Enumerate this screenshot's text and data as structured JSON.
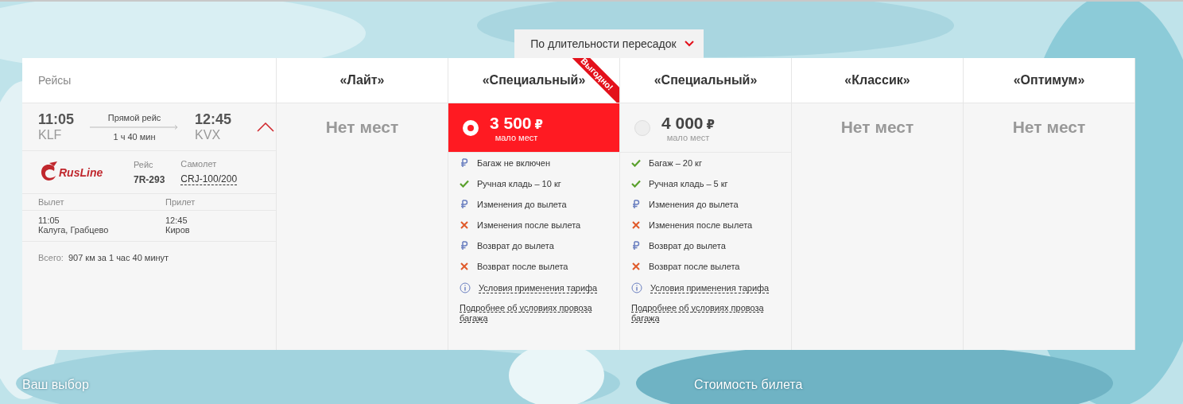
{
  "sort": {
    "label": "По длительности пересадок"
  },
  "flights_header": "Рейсы",
  "flight": {
    "departure_time": "11:05",
    "departure_code": "KLF",
    "type": "Прямой рейс",
    "duration": "1 ч 40 мин",
    "arrival_time": "12:45",
    "arrival_code": "KVX",
    "expanded": true,
    "airline": "RusLine",
    "flight_label": "Рейс",
    "flight_number": "7R-293",
    "aircraft_label": "Самолет",
    "aircraft": "CRJ-100/200",
    "departure_label": "Вылет",
    "arrival_label": "Прилет",
    "departure_time_detail": "11:05",
    "departure_city": "Калуга, Грабцево",
    "arrival_time_detail": "12:45",
    "arrival_city": "Киров",
    "total_label": "Всего:",
    "total": "907 км за 1 час 40 минут"
  },
  "tariffs": [
    {
      "name": "«Лайт»",
      "kind": "none",
      "status": "Нет мест"
    },
    {
      "name": "«Специальный»",
      "kind": "fare",
      "badge": "Выгодно!",
      "selected": true,
      "price": "3 500",
      "currency": "₽",
      "note": "мало мест",
      "features": [
        {
          "kind": "paid",
          "text": "Багаж не включен"
        },
        {
          "kind": "included",
          "text": "Ручная кладь – 10 кг"
        },
        {
          "kind": "paid",
          "text": "Изменения до вылета"
        },
        {
          "kind": "excluded",
          "text": "Изменения после вылета"
        },
        {
          "kind": "paid",
          "text": "Возврат до вылета"
        },
        {
          "kind": "excluded",
          "text": "Возврат после вылета"
        }
      ],
      "rules_link": "Условия применения тарифа",
      "baggage_link": "Подробнее об условиях провоза багажа"
    },
    {
      "name": "«Специальный»",
      "kind": "fare",
      "selected": false,
      "price": "4 000",
      "currency": "₽",
      "note": "мало мест",
      "features": [
        {
          "kind": "included",
          "text": "Багаж – 20 кг"
        },
        {
          "kind": "included",
          "text": "Ручная кладь – 5 кг"
        },
        {
          "kind": "paid",
          "text": "Изменения до вылета"
        },
        {
          "kind": "excluded",
          "text": "Изменения после вылета"
        },
        {
          "kind": "paid",
          "text": "Возврат до вылета"
        },
        {
          "kind": "excluded",
          "text": "Возврат после вылета"
        }
      ],
      "rules_link": "Условия применения тарифа",
      "baggage_link": "Подробнее об условиях провоза багажа"
    },
    {
      "name": "«Классик»",
      "kind": "none",
      "status": "Нет мест"
    },
    {
      "name": "«Оптимум»",
      "kind": "none",
      "status": "Нет мест"
    }
  ],
  "your_choice": "Ваш выбор",
  "ticket_price": "Стоимость билета"
}
